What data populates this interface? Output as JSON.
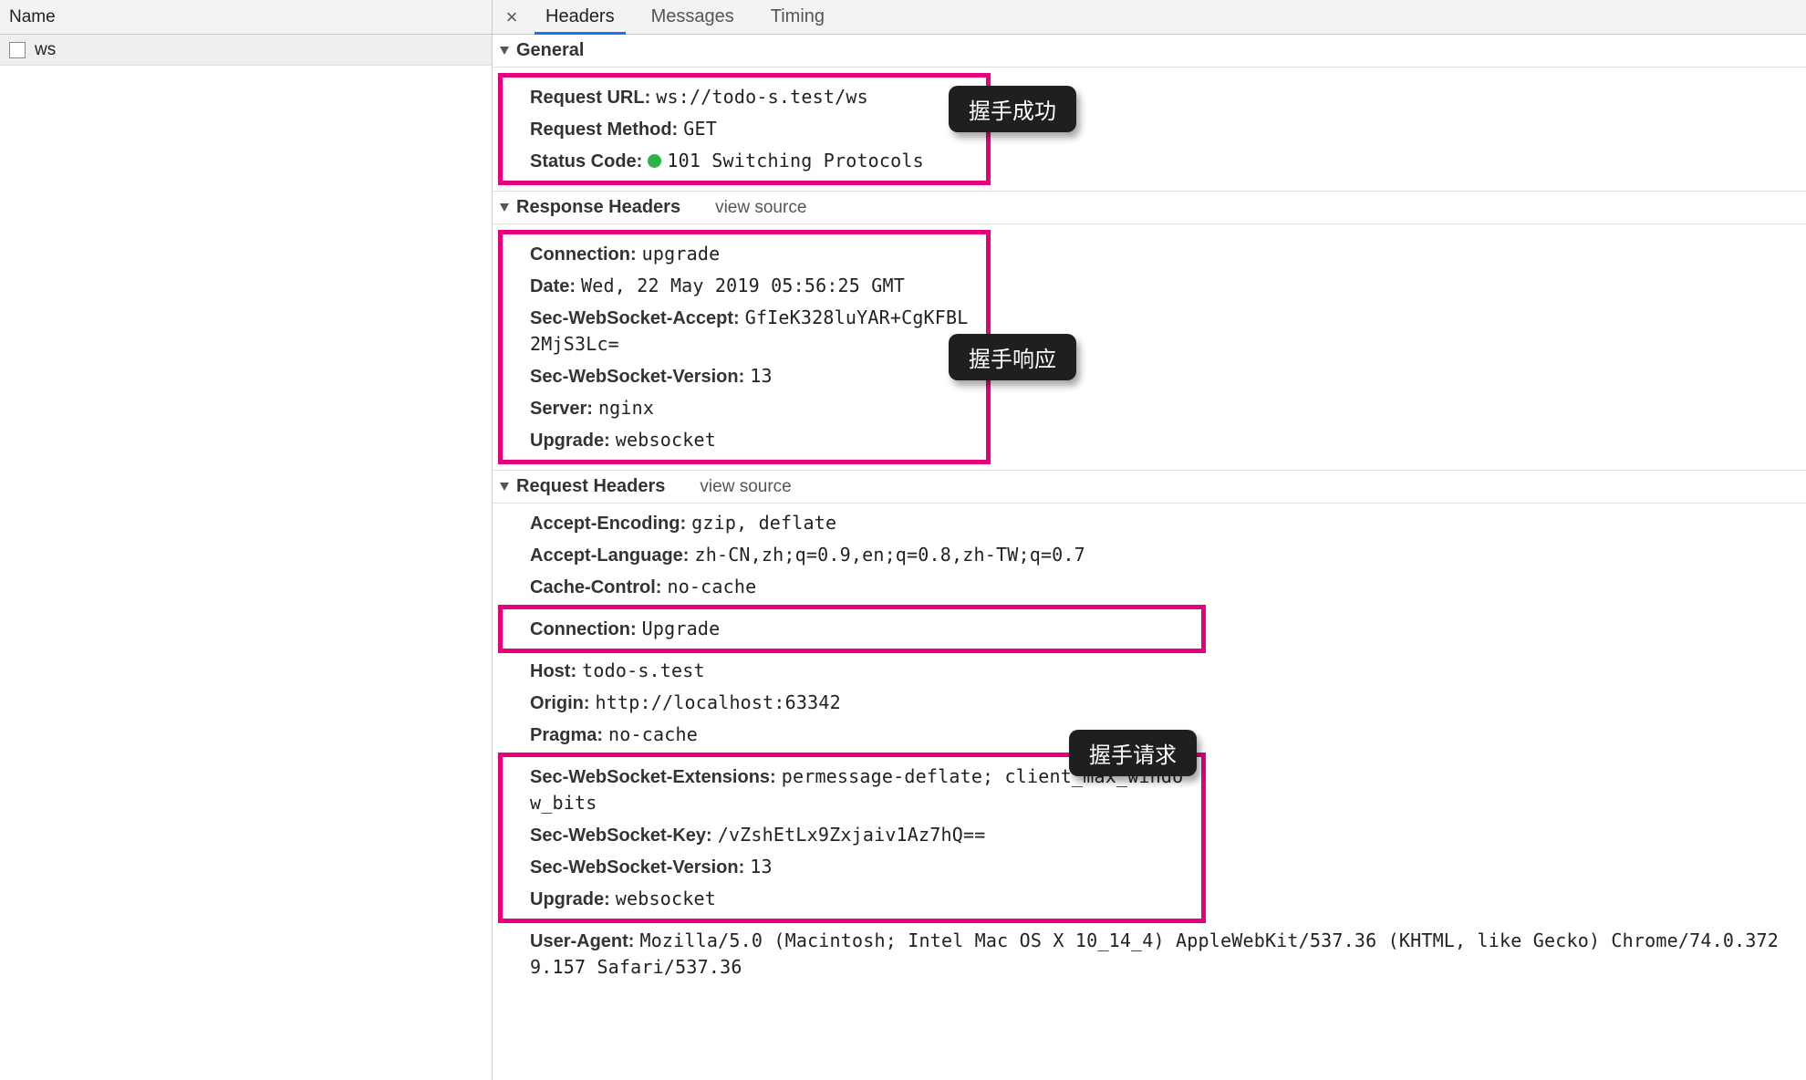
{
  "left": {
    "header": "Name",
    "row_name": "ws"
  },
  "tabs": {
    "close_glyph": "×",
    "headers": "Headers",
    "messages": "Messages",
    "timing": "Timing"
  },
  "sections": {
    "general": {
      "title": "General",
      "items": [
        {
          "key": "Request URL:",
          "val": "ws://todo-s.test/ws"
        },
        {
          "key": "Request Method:",
          "val": "GET"
        },
        {
          "key": "Status Code:",
          "val": "101 Switching Protocols",
          "status_dot": true
        }
      ]
    },
    "response": {
      "title": "Response Headers",
      "view_source": "view source",
      "items": [
        {
          "key": "Connection:",
          "val": "upgrade"
        },
        {
          "key": "Date:",
          "val": "Wed, 22 May 2019 05:56:25 GMT"
        },
        {
          "key": "Sec-WebSocket-Accept:",
          "val": "GfIeK328luYAR+CgKFBL2MjS3Lc="
        },
        {
          "key": "Sec-WebSocket-Version:",
          "val": "13"
        },
        {
          "key": "Server:",
          "val": "nginx"
        },
        {
          "key": "Upgrade:",
          "val": "websocket"
        }
      ]
    },
    "request": {
      "title": "Request Headers",
      "view_source": "view source",
      "pre_items": [
        {
          "key": "Accept-Encoding:",
          "val": "gzip, deflate"
        },
        {
          "key": "Accept-Language:",
          "val": "zh-CN,zh;q=0.9,en;q=0.8,zh-TW;q=0.7"
        },
        {
          "key": "Cache-Control:",
          "val": "no-cache"
        }
      ],
      "box1_items": [
        {
          "key": "Connection:",
          "val": "Upgrade"
        }
      ],
      "mid_items": [
        {
          "key": "Host:",
          "val": "todo-s.test"
        },
        {
          "key": "Origin:",
          "val": "http://localhost:63342"
        },
        {
          "key": "Pragma:",
          "val": "no-cache"
        }
      ],
      "box2_items": [
        {
          "key": "Sec-WebSocket-Extensions:",
          "val": "permessage-deflate; client_max_window_bits"
        },
        {
          "key": "Sec-WebSocket-Key:",
          "val": "/vZshEtLx9Zxjaiv1Az7hQ=="
        },
        {
          "key": "Sec-WebSocket-Version:",
          "val": "13"
        },
        {
          "key": "Upgrade:",
          "val": "websocket"
        }
      ],
      "post_items": [
        {
          "key": "User-Agent:",
          "val": "Mozilla/5.0 (Macintosh; Intel Mac OS X 10_14_4) AppleWebKit/537.36 (KHTML, like Gecko) Chrome/74.0.3729.157 Safari/537.36"
        }
      ]
    }
  },
  "annotations": {
    "handshake_success": "握手成功",
    "handshake_response": "握手响应",
    "handshake_request": "握手请求"
  },
  "colors": {
    "highlight": "#e6007e",
    "tab_active": "#1a73e8",
    "status_ok": "#28b446"
  }
}
